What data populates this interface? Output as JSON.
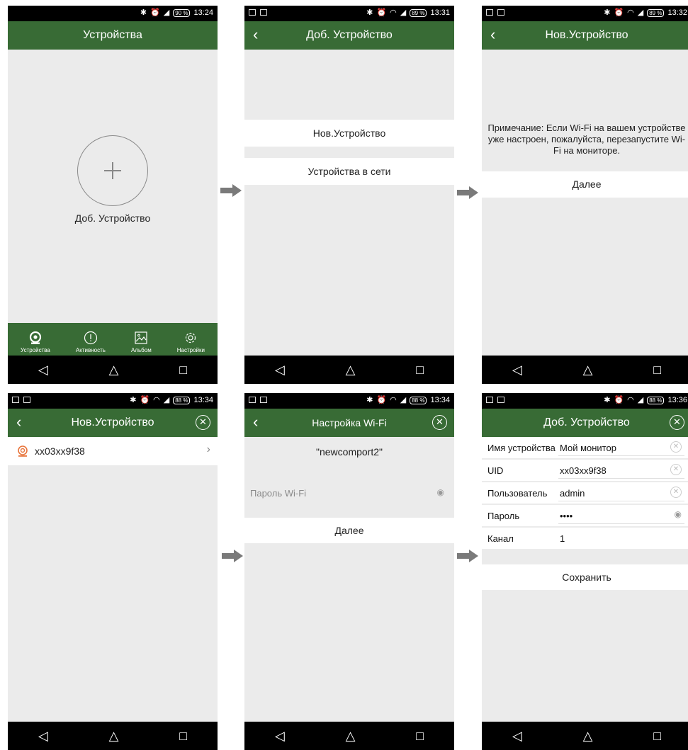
{
  "status": {
    "s1": {
      "time": "13:24",
      "battery": "90 %"
    },
    "s2": {
      "time": "13:31",
      "battery": "89 %"
    },
    "s3": {
      "time": "13:32",
      "battery": "89 %"
    },
    "s4": {
      "time": "13:34",
      "battery": "88 %"
    },
    "s5": {
      "time": "13:34",
      "battery": "88 %"
    },
    "s6": {
      "time": "13:36",
      "battery": "88 %"
    }
  },
  "screen1": {
    "title": "Устройства",
    "add_label": "Доб. Устройство",
    "tabs": [
      {
        "label": "Устройства",
        "icon": "camera-icon"
      },
      {
        "label": "Активность",
        "icon": "alert-circle-icon"
      },
      {
        "label": "Альбом",
        "icon": "image-icon"
      },
      {
        "label": "Настройки",
        "icon": "gear-icon"
      }
    ]
  },
  "screen2": {
    "title": "Доб. Устройство",
    "option_new": "Нов.Устройство",
    "option_network": "Устройства в сети"
  },
  "screen3": {
    "title": "Нов.Устройство",
    "note": "Примечание: Если Wi-Fi на вашем устройстве уже настроен, пожалуйста, перезапустите Wi-Fi на мониторе.",
    "next": "Далее"
  },
  "screen4": {
    "title": "Нов.Устройство",
    "device_uid": "xx03xx9f38"
  },
  "screen5": {
    "title": "Настройка Wi-Fi",
    "ssid": "\"newcomport2\"",
    "password_placeholder": "Пароль Wi-Fi",
    "next": "Далее"
  },
  "screen6": {
    "title": "Доб. Устройство",
    "fields": [
      {
        "label": "Имя устройства",
        "value": "Мой монитор"
      },
      {
        "label": "UID",
        "value": "xx03xx9f38"
      },
      {
        "label": "Пользователь",
        "value": "admin"
      },
      {
        "label": "Пароль",
        "value": "••••"
      },
      {
        "label": "Канал",
        "value": "1"
      }
    ],
    "save": "Сохранить"
  },
  "colors": {
    "appbar": "#386b35",
    "background": "#ebebeb"
  }
}
